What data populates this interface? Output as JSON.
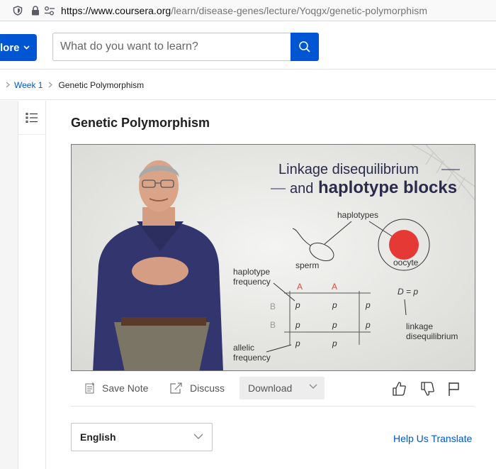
{
  "browser": {
    "url_host": "https://www.coursera.org",
    "url_path": "/learn/disease-genes/lecture/Yoqgx/genetic-polymorphism"
  },
  "header": {
    "explore_label": "lore",
    "search_placeholder": "What do you want to learn?",
    "accent": "#0056d2"
  },
  "breadcrumb": {
    "week": "Week 1",
    "current": "Genetic Polymorphism"
  },
  "lecture": {
    "title": "Genetic Polymorphism"
  },
  "slide": {
    "title_line1": "Linkage disequilibrium",
    "title_line2_a": "and ",
    "title_line2_b": "haplotype blocks",
    "haplotypes": "haplotypes",
    "sperm": "sperm",
    "oocyte": "oocyte",
    "haplotype_frequency_1": "haplotype",
    "haplotype_frequency_2": "frequency",
    "allelic_frequency_1": "allelic",
    "allelic_frequency_2": "frequency",
    "linkage_1": "linkage",
    "linkage_2": "disequilibrium",
    "a1": "A",
    "a2": "A",
    "b1": "B",
    "b2": "B",
    "formula": "D = p"
  },
  "toolbar": {
    "save_note": "Save Note",
    "discuss": "Discuss",
    "download": "Download"
  },
  "language": {
    "selected": "English",
    "help_translate": "Help Us Translate"
  }
}
